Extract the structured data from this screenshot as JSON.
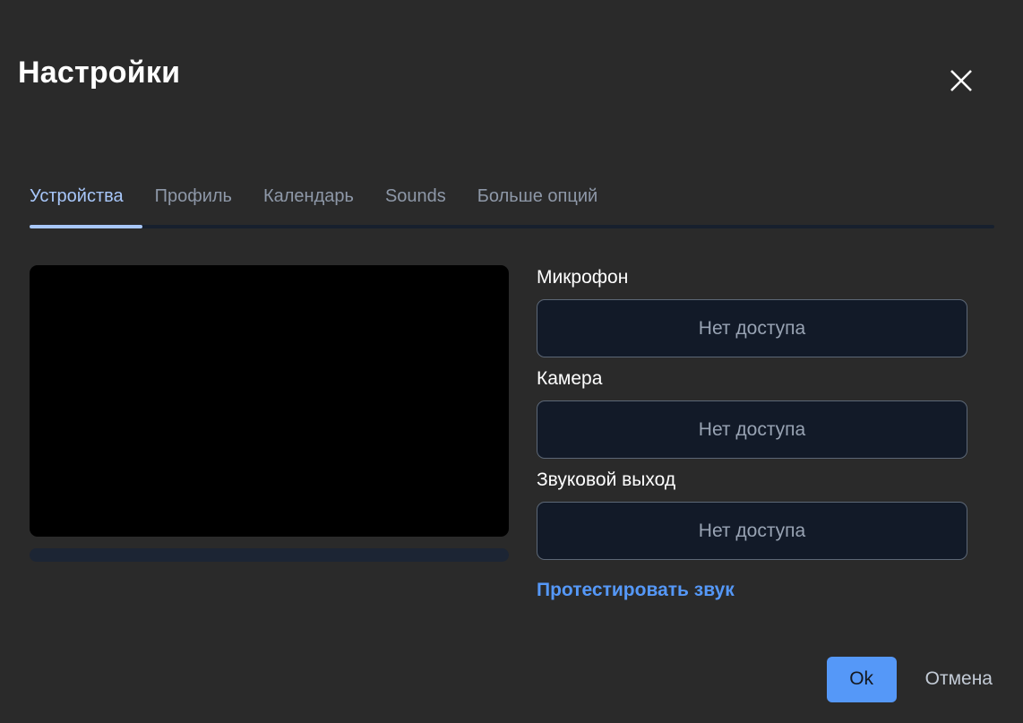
{
  "dialog": {
    "title": "Настройки",
    "close_icon": "close-icon"
  },
  "tabs": [
    {
      "label": "Устройства",
      "active": true
    },
    {
      "label": "Профиль",
      "active": false
    },
    {
      "label": "Календарь",
      "active": false
    },
    {
      "label": "Sounds",
      "active": false
    },
    {
      "label": "Больше опций",
      "active": false
    }
  ],
  "preview": {
    "video_placeholder": "",
    "audio_level_percent": 0
  },
  "devices": [
    {
      "label": "Микрофон",
      "value": "Нет доступа"
    },
    {
      "label": "Камера",
      "value": "Нет доступа"
    },
    {
      "label": "Звуковой выход",
      "value": "Нет доступа"
    }
  ],
  "actions": {
    "test_sound": "Протестировать звук",
    "ok": "Ok",
    "cancel": "Отмена"
  },
  "colors": {
    "background": "#2a2a2a",
    "accent_blue": "#5598f8",
    "tab_active": "#a8c7fa",
    "tab_inactive": "#8e98a8",
    "select_bg": "#121a28",
    "select_border": "#5c6776",
    "select_text": "#98a3b3",
    "meter_track": "#1c2534"
  }
}
